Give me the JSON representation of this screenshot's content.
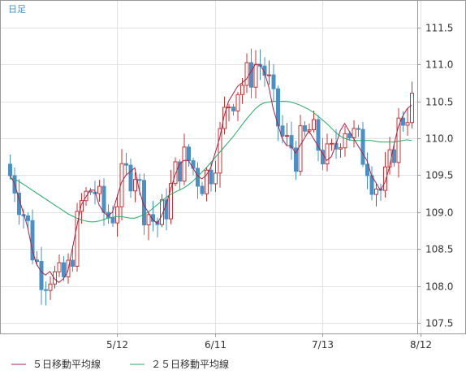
{
  "chart_data": {
    "type": "candlestick",
    "period_label": "日足",
    "x_tick_labels": [
      "5/12",
      "6/11",
      "7/13",
      "8/12"
    ],
    "x_tick_index": [
      24,
      46,
      70,
      92
    ],
    "ylim": [
      107.36,
      111.86
    ],
    "y_ticks": [
      107.5,
      108.0,
      108.5,
      109.0,
      109.5,
      110.0,
      110.5,
      111.0,
      111.5
    ],
    "y_tick_labels": [
      "107.5",
      "108.0",
      "108.5",
      "109.0",
      "109.5",
      "110.0",
      "110.5",
      "111.0",
      "111.5"
    ],
    "grid": true,
    "up_color": "#cc3333",
    "down_color": "#4a90c8",
    "series": [
      {
        "name": "５日移動平均線",
        "color": "#aa2244",
        "values": [
          109.5,
          109.4,
          109.2,
          109.0,
          108.8,
          108.5,
          108.3,
          108.2,
          108.15,
          108.2,
          108.1,
          108.05,
          108.1,
          108.2,
          108.5,
          108.8,
          109.1,
          109.2,
          109.3,
          109.3,
          109.1,
          109.0,
          108.95,
          109.0,
          109.2,
          109.4,
          109.5,
          109.55,
          109.6,
          109.3,
          109.1,
          109.0,
          108.9,
          108.85,
          108.95,
          109.1,
          109.3,
          109.5,
          109.65,
          109.7,
          109.7,
          109.6,
          109.5,
          109.45,
          109.5,
          109.6,
          109.8,
          110.0,
          110.3,
          110.5,
          110.6,
          110.7,
          110.75,
          110.8,
          110.9,
          111.0,
          111.0,
          110.9,
          110.7,
          110.4,
          110.2,
          110.0,
          109.9,
          109.9,
          109.8,
          109.9,
          110.0,
          110.1,
          110.0,
          109.9,
          109.8,
          109.7,
          109.75,
          109.9,
          110.1,
          110.2,
          110.1,
          110.0,
          109.9,
          109.8,
          109.7,
          109.5,
          109.4,
          109.3,
          109.4,
          109.6,
          109.9,
          110.15,
          110.3,
          110.4,
          110.45
        ]
      },
      {
        "name": "２５日移動平均線",
        "color": "#22aa66",
        "values": [
          109.45,
          109.45,
          109.42,
          109.38,
          109.34,
          109.3,
          109.26,
          109.22,
          109.18,
          109.14,
          109.1,
          109.06,
          109.02,
          108.98,
          108.95,
          108.92,
          108.9,
          108.88,
          108.87,
          108.87,
          108.88,
          108.9,
          108.92,
          108.93,
          108.94,
          108.94,
          108.93,
          108.92,
          108.92,
          108.94,
          108.97,
          109.0,
          109.05,
          109.1,
          109.15,
          109.2,
          109.24,
          109.27,
          109.3,
          109.33,
          109.37,
          109.42,
          109.48,
          109.54,
          109.6,
          109.67,
          109.74,
          109.81,
          109.88,
          109.95,
          110.02,
          110.1,
          110.18,
          110.26,
          110.33,
          110.4,
          110.45,
          110.48,
          110.49,
          110.5,
          110.5,
          110.5,
          110.5,
          110.49,
          110.47,
          110.45,
          110.42,
          110.39,
          110.35,
          110.3,
          110.25,
          110.2,
          110.14,
          110.08,
          110.03,
          110.0,
          109.98,
          109.97,
          109.97,
          109.97,
          109.97,
          109.97,
          109.96,
          109.95,
          109.95,
          109.95,
          109.95,
          109.96,
          109.97,
          109.98,
          109.97
        ]
      }
    ]
  }
}
